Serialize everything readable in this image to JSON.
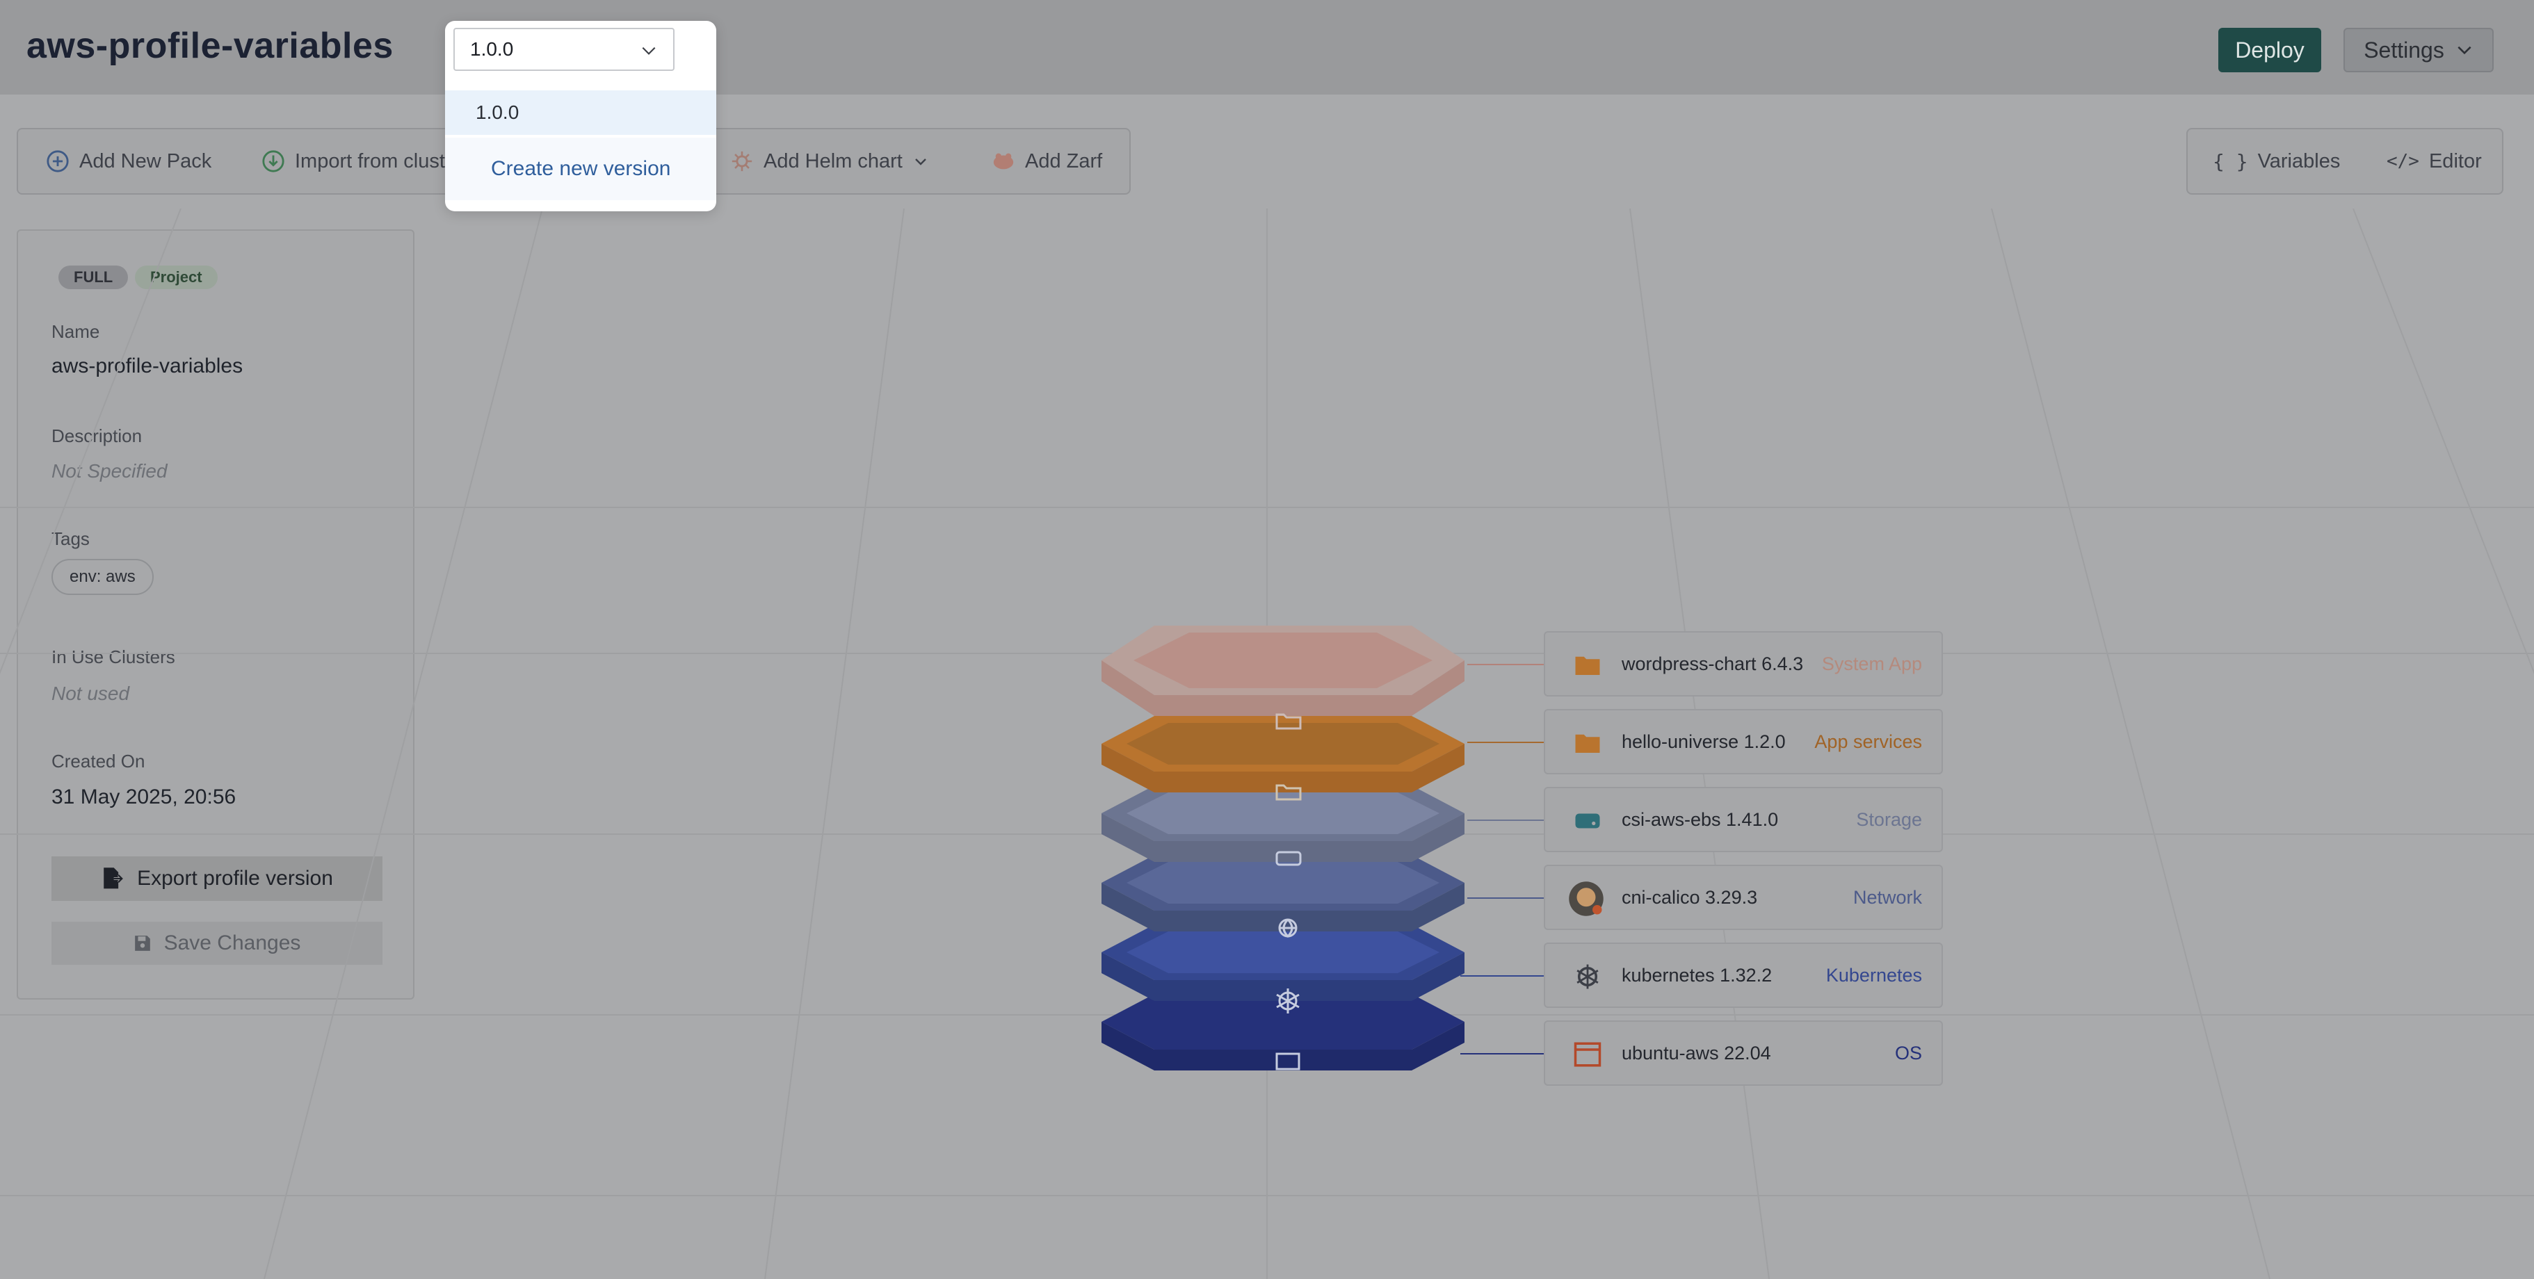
{
  "header": {
    "title": "aws-profile-variables",
    "deploy_label": "Deploy",
    "settings_label": "Settings"
  },
  "version_dropdown": {
    "selected": "1.0.0",
    "options": [
      "1.0.0"
    ],
    "create_label": "Create new version"
  },
  "toolbar": {
    "add_pack": "Add New Pack",
    "import_cluster": "Import from cluster",
    "add_helm": "Add Helm chart",
    "add_zarf": "Add Zarf",
    "variables": "Variables",
    "editor": "Editor"
  },
  "details": {
    "badges": [
      "FULL",
      "Project"
    ],
    "name_label": "Name",
    "name_value": "aws-profile-variables",
    "description_label": "Description",
    "description_value": "Not Specified",
    "tags_label": "Tags",
    "tags": [
      "env: aws"
    ],
    "clusters_label": "In Use Clusters",
    "clusters_value": "Not used",
    "created_label": "Created On",
    "created_value": "31 May 2025, 20:56",
    "export_label": "Export profile version",
    "save_label": "Save Changes"
  },
  "layers": [
    {
      "name": "wordpress-chart 6.4.3",
      "type": "System App",
      "color": "#c98f80",
      "icon": "folder-icon"
    },
    {
      "name": "hello-universe 1.2.0",
      "type": "App services",
      "color": "#b9742e",
      "icon": "folder-icon"
    },
    {
      "name": "csi-aws-ebs 1.41.0",
      "type": "Storage",
      "color": "#6c7591",
      "icon": "storage-icon"
    },
    {
      "name": "cni-calico 3.29.3",
      "type": "Network",
      "color": "#4c5a8a",
      "icon": "calico-icon"
    },
    {
      "name": "kubernetes 1.32.2",
      "type": "Kubernetes",
      "color": "#34478f",
      "icon": "kubernetes-icon"
    },
    {
      "name": "ubuntu-aws 22.04",
      "type": "OS",
      "color": "#25317a",
      "icon": "os-window-icon"
    }
  ]
}
